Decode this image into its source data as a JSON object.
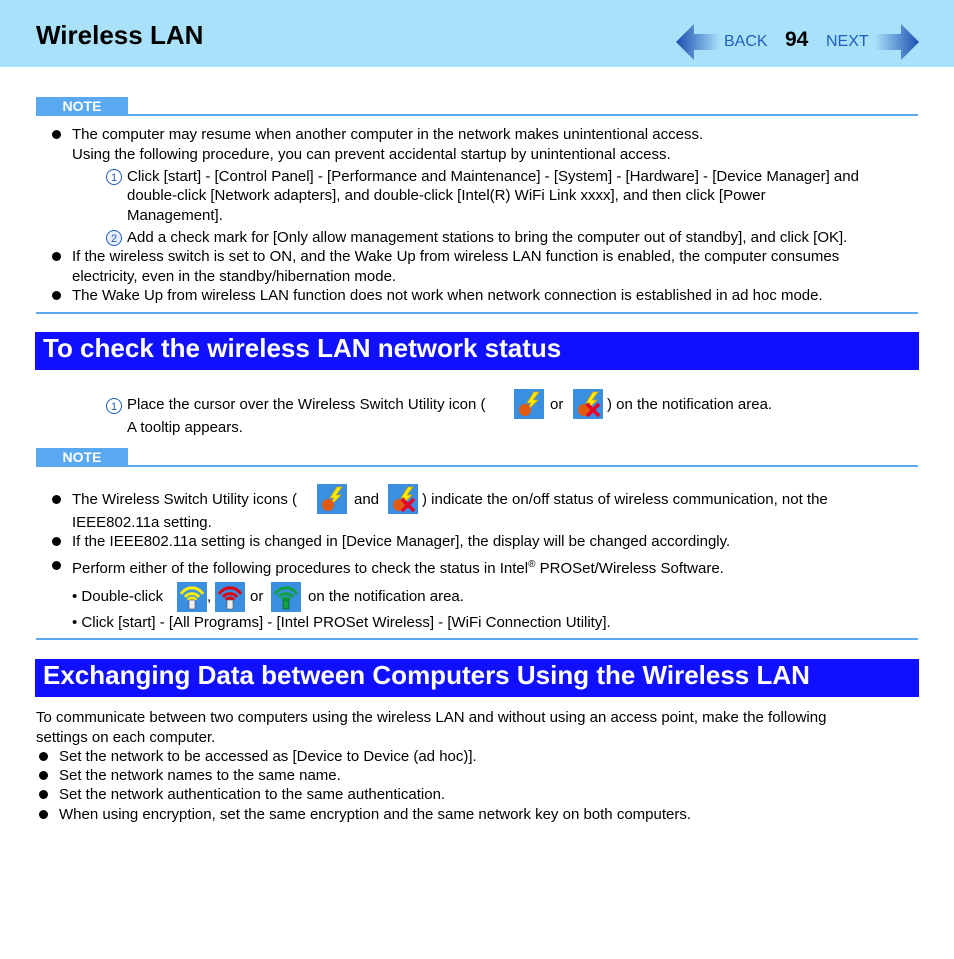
{
  "header": {
    "title": "Wireless LAN",
    "back_label": "BACK",
    "page_number": "94",
    "next_label": "NEXT"
  },
  "note1": {
    "label": "NOTE",
    "bullet1_line1": "The computer may resume when another computer in the network makes unintentional access.",
    "bullet1_line2": "Using the following procedure, you can prevent accidental startup by unintentional access.",
    "step1_num": "1",
    "step1_line1": "Click [start] - [Control Panel] - [Performance and Maintenance] - [System] - [Hardware] - [Device Manager] and",
    "step1_line2": "double-click [Network adapters], and double-click [Intel(R) WiFi Link xxxx], and then click [Power",
    "step1_line3": "Management].",
    "step2_num": "2",
    "step2_line1": "Add a check mark for [Only allow management stations to bring the computer out of standby], and click [OK].",
    "bullet2_line1": "If the wireless switch is set to ON, and the Wake Up from wireless LAN function is enabled, the computer consumes",
    "bullet2_line2": "electricity, even in the standby/hibernation mode.",
    "bullet3_line1": "The Wake Up from wireless LAN function does not work when network connection is established in ad hoc mode."
  },
  "section1": {
    "heading": "To check the wireless LAN network status",
    "step_num": "1",
    "step_text_a": "Place the cursor over the Wireless Switch Utility icon (",
    "step_text_or": "or",
    "step_text_b": ") on the notification area.",
    "step_line2": "A tooltip appears."
  },
  "note2": {
    "label": "NOTE",
    "bullet1_a": "The Wireless Switch Utility icons (",
    "bullet1_and": "and",
    "bullet1_b": ") indicate the on/off status of wireless communication, not the",
    "bullet1_line2": "IEEE802.11a setting.",
    "bullet2": "If the IEEE802.11a setting is changed in [Device Manager], the display will be changed accordingly.",
    "bullet3_a": "Perform either of the following procedures to check the status in Intel",
    "bullet3_reg": "®",
    "bullet3_b": " PROSet/Wireless Software.",
    "sub1_a": "• Double-click",
    "sub1_comma": ",",
    "sub1_or": "or",
    "sub1_b": "on the notification area.",
    "sub2": "• Click [start] - [All Programs] - [Intel PROSet Wireless] - [WiFi Connection Utility]."
  },
  "section2": {
    "heading": "Exchanging Data between Computers Using the Wireless LAN",
    "intro_line1": "To communicate between two computers using the wireless LAN and without using an access point, make the following",
    "intro_line2": "settings on each computer.",
    "bullets": [
      "Set the network to be accessed as [Device to Device (ad hoc)].",
      "Set the network names to the same name.",
      "Set the network authentication to the same authentication.",
      "When using encryption, set the same encryption and the same network key on both computers."
    ]
  },
  "colors": {
    "header_bg": "#a9e1fa",
    "heading_bg": "#1010ff",
    "note_blue": "#5aa8f0",
    "link_blue": "#1f5fbf"
  }
}
